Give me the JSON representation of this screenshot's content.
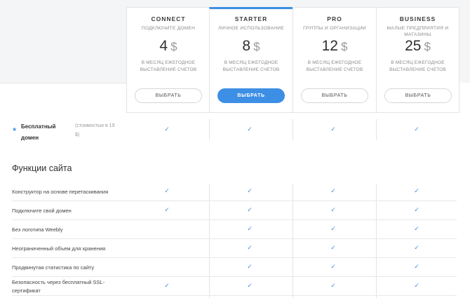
{
  "plans": [
    {
      "name": "CONNECT",
      "subtitle": "ПОДКЛЮЧИТЕ ДОМЕН",
      "price": "4",
      "currency": "$",
      "period": "В МЕСЯЦ ЕЖЕГОДНОЕ ВЫСТАВЛЕНИЕ СЧЕТОВ",
      "button": "ВЫБРАТЬ"
    },
    {
      "name": "STARTER",
      "subtitle": "ЛИЧНОЕ ИСПОЛЬЗОВАНИЕ",
      "price": "8",
      "currency": "$",
      "period": "В МЕСЯЦ ЕЖЕГОДНОЕ ВЫСТАВЛЕНИЕ СЧЕТОВ",
      "button": "ВЫБРАТЬ"
    },
    {
      "name": "PRO",
      "subtitle": "ГРУППЫ И ОРГАНИЗАЦИИ",
      "price": "12",
      "currency": "$",
      "period": "В МЕСЯЦ ЕЖЕГОДНОЕ ВЫСТАВЛЕНИЕ СЧЕТОВ",
      "button": "ВЫБРАТЬ"
    },
    {
      "name": "BUSINESS",
      "subtitle": "МАЛЫЕ ПРЕДПРИЯТИЯ И МАГАЗИНЫ",
      "price": "25",
      "currency": "$",
      "period": "В МЕСЯЦ ЕЖЕГОДНОЕ ВЫСТАВЛЕНИЕ СЧЕТОВ",
      "button": "ВЫБРАТЬ"
    }
  ],
  "free_domain": {
    "label": "Бесплатный домен",
    "note": "(стоимостью в 19 $)",
    "checks": [
      true,
      true,
      true,
      true
    ]
  },
  "section_title": "Функции сайта",
  "check_glyph": "✓",
  "features": [
    {
      "label": "Конструктор на основе перетаскивания",
      "checks": [
        true,
        true,
        true,
        true
      ]
    },
    {
      "label": "Подключите свой домен",
      "checks": [
        true,
        true,
        true,
        true
      ]
    },
    {
      "label": "Без логотипа Weebly",
      "checks": [
        false,
        true,
        true,
        true
      ]
    },
    {
      "label": "Неограниченный объем для хранения",
      "checks": [
        false,
        true,
        true,
        true
      ]
    },
    {
      "label": "Продвинутая статистика по сайту",
      "checks": [
        false,
        true,
        true,
        true
      ]
    },
    {
      "label": "Безопасность через бесплатный SSL-сертификат",
      "checks": [
        true,
        true,
        true,
        true
      ]
    }
  ],
  "colors": {
    "accent": "#3d8fe5",
    "band": "#f4f5f6"
  }
}
